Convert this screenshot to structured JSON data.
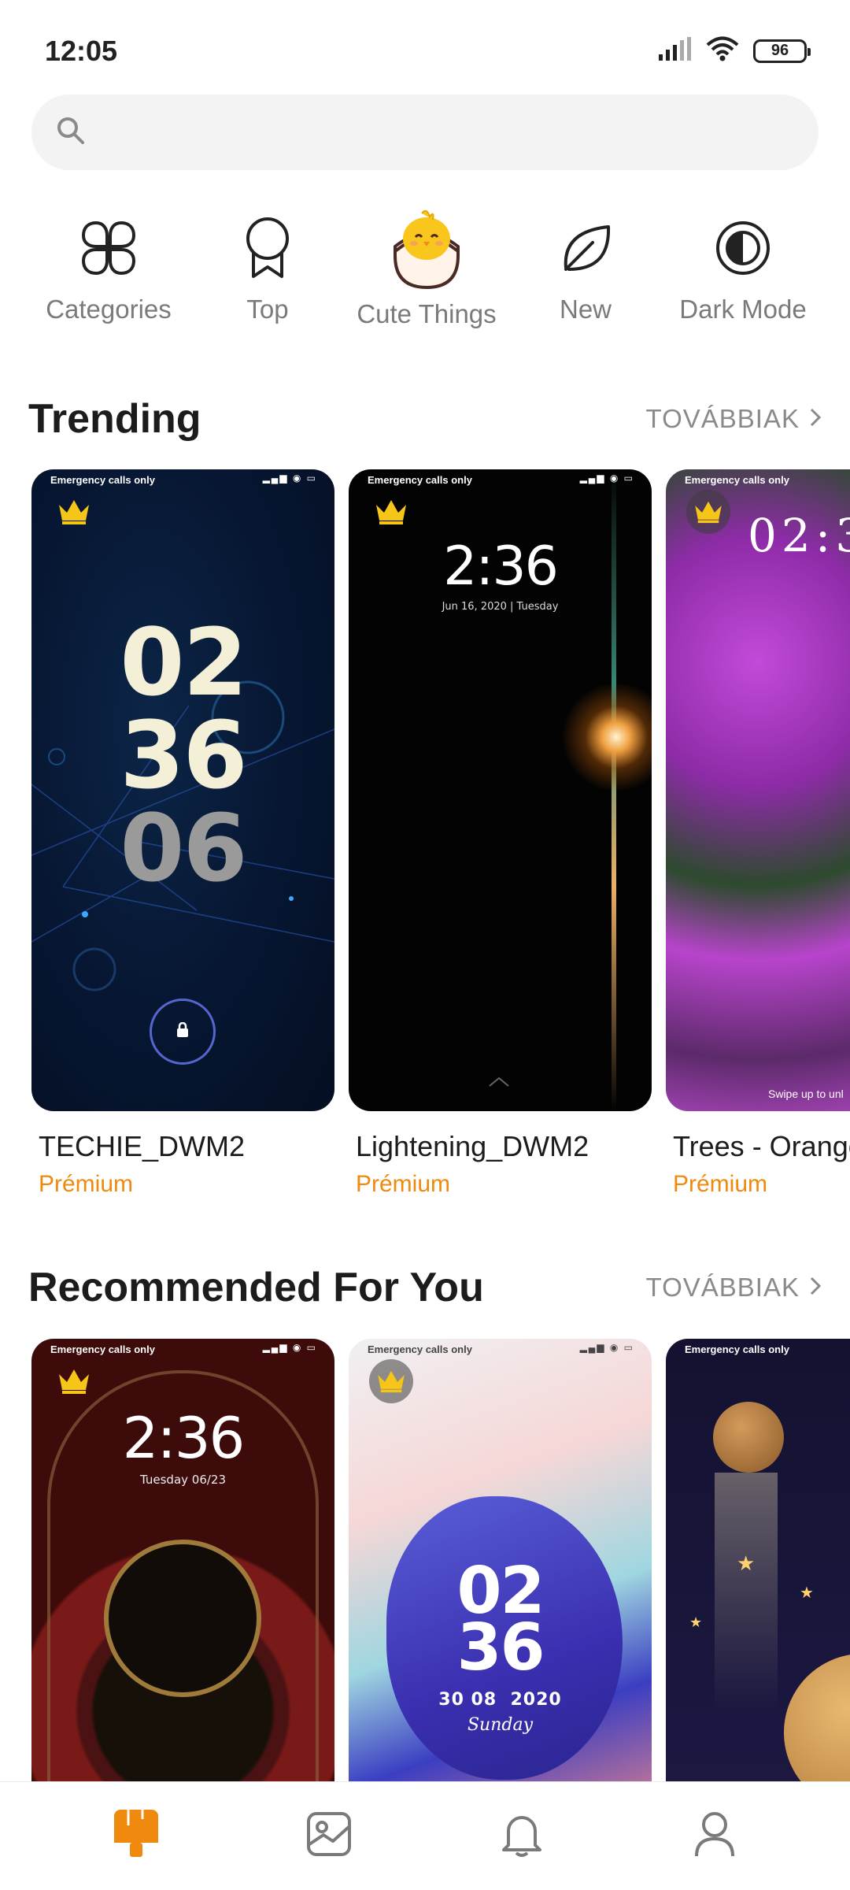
{
  "status": {
    "time": "12:05",
    "battery": "96"
  },
  "search": {
    "placeholder": ""
  },
  "quick_nav": [
    {
      "label": "Categories",
      "icon": "categories-icon"
    },
    {
      "label": "Top",
      "icon": "ribbon-icon"
    },
    {
      "label": "Cute Things",
      "icon": "chick-egg-icon"
    },
    {
      "label": "New",
      "icon": "leaf-icon"
    },
    {
      "label": "Dark Mode",
      "icon": "dark-mode-icon"
    }
  ],
  "trending": {
    "title": "Trending",
    "more": "TOVÁBBIAK",
    "items": [
      {
        "name": "TECHIE_DWM2",
        "price": "Prémium",
        "status": "Emergency calls only",
        "digits": [
          "02",
          "36",
          "06"
        ]
      },
      {
        "name": "Lightening_DWM2",
        "price": "Prémium",
        "status": "Emergency calls only",
        "time": "2:36",
        "date": "Jun 16, 2020 | Tuesday"
      },
      {
        "name": "Trees - Orange",
        "price": "Prémium",
        "status": "Emergency calls only",
        "time": "02:3",
        "hint": "Swipe up to unl"
      }
    ]
  },
  "recommended": {
    "title": "Recommended For You",
    "more": "TOVÁBBIAK",
    "items": [
      {
        "status": "Emergency calls only",
        "time": "2:36",
        "date": "Tuesday 06/23"
      },
      {
        "status": "Emergency calls only",
        "digits": [
          "02",
          "36"
        ],
        "date": "30 08  2020",
        "day": "Sunday"
      },
      {
        "status": "Emergency calls only"
      }
    ]
  },
  "bottom_nav": [
    {
      "icon": "themes-icon",
      "active": true
    },
    {
      "icon": "wallpaper-icon",
      "active": false
    },
    {
      "icon": "notification-bell-icon",
      "active": false
    },
    {
      "icon": "profile-icon",
      "active": false
    }
  ],
  "colors": {
    "accent": "#ef8a0e",
    "muted": "#7a7a7a",
    "search_bg": "#f3f3f3"
  }
}
